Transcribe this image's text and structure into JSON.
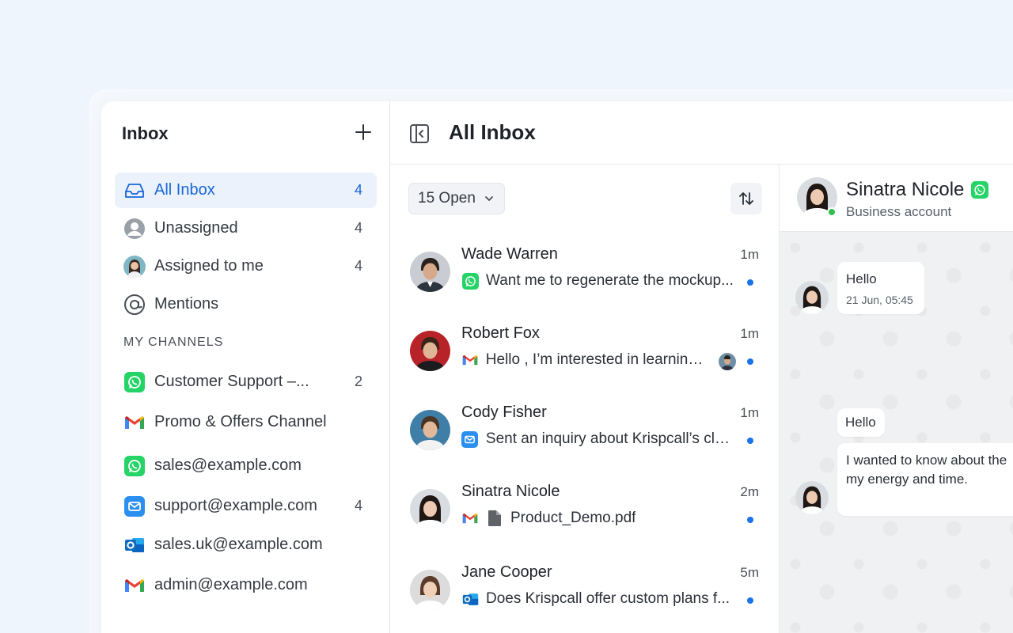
{
  "sidebar": {
    "title": "Inbox",
    "items": [
      {
        "label": "All Inbox",
        "count": "4"
      },
      {
        "label": "Unassigned",
        "count": "4"
      },
      {
        "label": "Assigned to me",
        "count": "4"
      },
      {
        "label": "Mentions",
        "count": ""
      }
    ],
    "section_label": "MY CHANNELS",
    "channels": [
      {
        "label": "Customer Support –...",
        "count": "2",
        "icon": "whatsapp-icon"
      },
      {
        "label": "Promo & Offers Channel",
        "count": "",
        "icon": "gmail-icon"
      },
      {
        "label": "sales@example.com",
        "count": "",
        "icon": "whatsapp-icon"
      },
      {
        "label": "support@example.com",
        "count": "4",
        "icon": "mail-icon"
      },
      {
        "label": "sales.uk@example.com",
        "count": "",
        "icon": "outlook-icon"
      },
      {
        "label": "admin@example.com",
        "count": "",
        "icon": "gmail-icon"
      }
    ]
  },
  "main": {
    "title": "All Inbox",
    "filter_label": "15 Open"
  },
  "conversations": [
    {
      "name": "Wade Warren",
      "time": "1m",
      "preview": "Want me to regenerate the mockup...",
      "channel": "whatsapp-icon"
    },
    {
      "name": "Robert Fox",
      "time": "1m",
      "preview": "Hello , I’m interested in learning...",
      "channel": "gmail-icon"
    },
    {
      "name": "Cody Fisher",
      "time": "1m",
      "preview": "Sent an inquiry about Krispcall’s clo...",
      "channel": "mail-icon"
    },
    {
      "name": "Sinatra Nicole",
      "time": "2m",
      "preview": "Product_Demo.pdf",
      "channel": "gmail-icon"
    },
    {
      "name": "Jane Cooper",
      "time": "5m",
      "preview": "Does Krispcall offer custom plans f...",
      "channel": "outlook-icon"
    }
  ],
  "chat": {
    "name": "Sinatra Nicole",
    "subtitle": "Business account",
    "messages": [
      {
        "text": "Hello",
        "time": "21 Jun, 05:45"
      },
      {
        "text": "Hello"
      },
      {
        "text_line1": "I wanted to know about the",
        "text_line2": "my energy and time."
      }
    ]
  },
  "colors": {
    "accent": "#1a66d6",
    "active_bg": "#ebf2fc",
    "unread_dot": "#1a73e8",
    "whatsapp": "#25d366",
    "online": "#2fbf4f"
  }
}
